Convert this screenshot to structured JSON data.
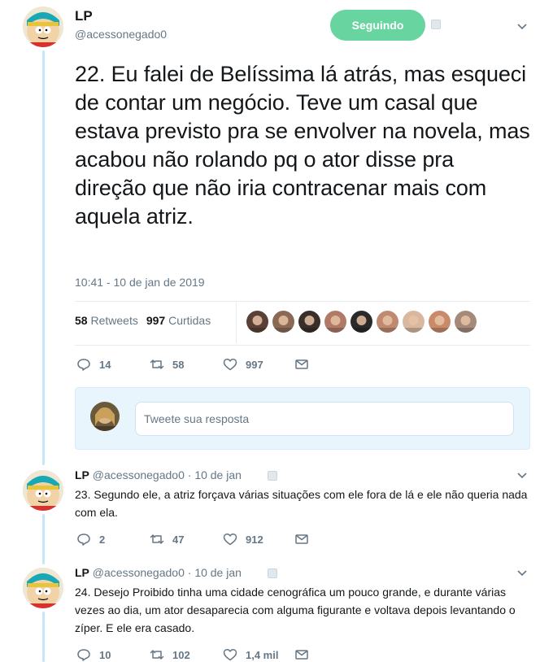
{
  "main": {
    "name": "LP",
    "handle": "@acessonegado0",
    "follow_label": "Seguindo",
    "text": "22. Eu falei de Belíssima lá atrás, mas esqueci de contar um negócio. Teve um casal que estava previsto pra se envolver na novela, mas acabou não rolando pq o ator disse pra direção que não iria contracenar mais com aquela atriz.",
    "timestamp": "10:41 - 10 de jan de 2019",
    "retweets_count": "58",
    "retweets_label": "Retweets",
    "likes_count": "997",
    "likes_label": "Curtidas",
    "actions": {
      "replies": "14",
      "retweets": "58",
      "likes": "997"
    }
  },
  "reply_box": {
    "placeholder": "Tweete sua resposta"
  },
  "replies": [
    {
      "name": "LP",
      "handle": "@acessonegado0",
      "sep": "·",
      "date": "10 de jan",
      "text": "23. Segundo ele, a atriz forçava várias situações com ele fora de lá e ele não queria nada com ela.",
      "actions": {
        "replies": "2",
        "retweets": "47",
        "likes": "912"
      }
    },
    {
      "name": "LP",
      "handle": "@acessonegado0",
      "sep": "·",
      "date": "10 de jan",
      "text": "24. Desejo Proibido tinha uma cidade cenográfica um pouco grande, e durante várias vezes ao dia, um ator desaparecia com alguma figurante e voltava depois levantando o zíper. E ele era casado.",
      "actions": {
        "replies": "10",
        "retweets": "102",
        "likes": "1,4 mil"
      }
    }
  ],
  "colors": {
    "follow_button": "#68d5a0",
    "thread_line": "#c4e8f9",
    "muted_text": "#657786",
    "reply_box_bg": "#e8f5fd"
  },
  "liker_faces": [
    "#5a4036",
    "#8a6a55",
    "#3a2e2a",
    "#b07a66",
    "#2a2a2a",
    "#c08a70",
    "#d8b9a0",
    "#c98a6a",
    "#a58a7a"
  ]
}
